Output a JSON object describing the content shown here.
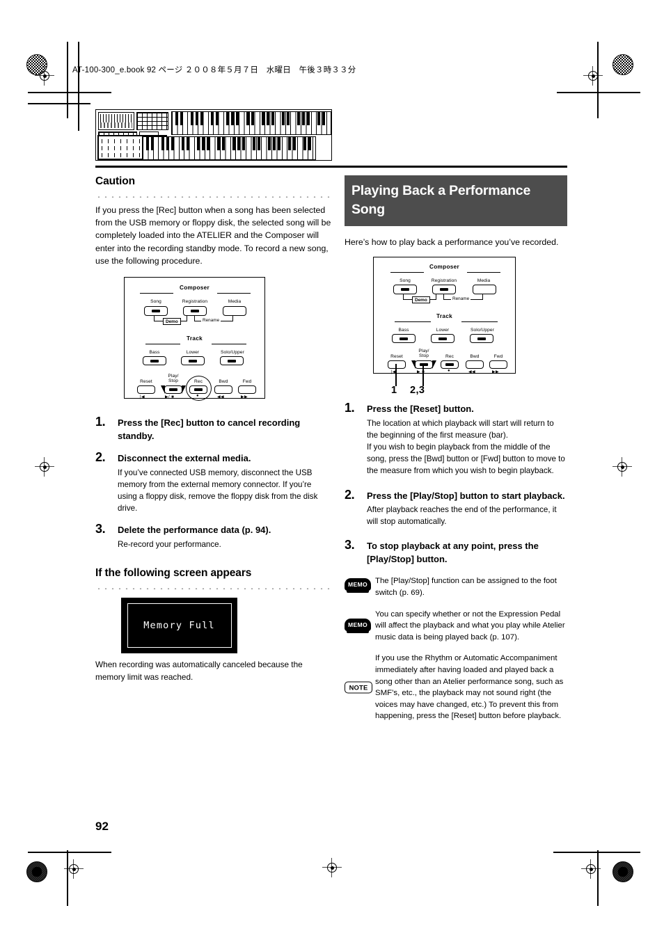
{
  "page": {
    "file_header": "AT-100-300_e.book  92 ページ  ２００８年５月７日　水曜日　午後３時３３分",
    "page_number": "92"
  },
  "left_column": {
    "caution": {
      "heading": "Caution",
      "body": "If you press the [Rec] button when a song has been selected from the USB memory or floppy disk, the selected song will be completely loaded into the ATELIER and the Composer will enter into the recording standby mode. To record a new song, use the following procedure."
    },
    "diagram": {
      "composer_label": "Composer",
      "track_label": "Track",
      "buttons": {
        "song": "Song",
        "registration": "Registration",
        "media": "Media",
        "demo": "Demo",
        "rename": "Rename",
        "bass": "Bass",
        "lower": "Lower",
        "solo_upper": "Solo/Upper",
        "reset": "Reset",
        "play_stop": "Play/\nStop",
        "play_line1": "Play/",
        "play_line2": "Stop",
        "rec": "Rec",
        "bwd": "Bwd",
        "fwd": "Fwd"
      },
      "transport_symbols": {
        "reset": "|◀",
        "play_stop": "▶/ ■",
        "rec": "●",
        "bwd": "◀◀",
        "fwd": "▶▶"
      }
    },
    "steps": [
      {
        "num": "1.",
        "lead": "Press the [Rec] button to cancel recording standby.",
        "sub": ""
      },
      {
        "num": "2.",
        "lead": "Disconnect the external media.",
        "sub": "If you’ve connected USB memory, disconnect the USB memory from the external memory connector. If you’re using a floppy disk, remove the floppy disk from the disk drive."
      },
      {
        "num": "3.",
        "lead": "Delete the performance data (p. 94).",
        "sub": "Re-record your performance."
      }
    ],
    "screen_section": {
      "heading": "If the following screen appears",
      "lcd_text": "Memory Full",
      "caption": "When recording was automatically canceled because the memory limit was reached."
    }
  },
  "right_column": {
    "banner_title": "Playing Back a Performance Song",
    "intro": "Here’s how to play back a performance you’ve recorded.",
    "diagram": {
      "composer_label": "Composer",
      "track_label": "Track",
      "buttons": {
        "song": "Song",
        "registration": "Registration",
        "media": "Media",
        "demo": "Demo",
        "rename": "Rename",
        "bass": "Bass",
        "lower": "Lower",
        "solo_upper": "Solo/Upper",
        "reset": "Reset",
        "play_line1": "Play/",
        "play_line2": "Stop",
        "rec": "Rec",
        "bwd": "Bwd",
        "fwd": "Fwd"
      },
      "transport_symbols": {
        "reset": "|◀",
        "play_stop": "▶ ■",
        "rec": "●",
        "bwd": "◀◀",
        "fwd": "▶▶"
      },
      "callouts": {
        "reset_callout": "1",
        "play_callout": "2,3"
      }
    },
    "steps": [
      {
        "num": "1.",
        "lead": "Press the [Reset] button.",
        "sub": "The location at which playback will start will return to the beginning of the first measure (bar).\nIf you wish to begin playback from the middle of the song, press the [Bwd] button or [Fwd] button to move to the measure from which you wish to begin playback."
      },
      {
        "num": "2.",
        "lead": "Press the [Play/Stop] button to start playback.",
        "sub": "After playback reaches the end of the performance, it will stop automatically."
      },
      {
        "num": "3.",
        "lead": "To stop playback at any point, press the [Play/Stop] button.",
        "sub": ""
      }
    ],
    "callouts": [
      {
        "badge": "MEMO",
        "text": "The [Play/Stop] function can be assigned to the foot switch (p. 69)."
      },
      {
        "badge": "MEMO",
        "text": "You can specify whether or not the Expression Pedal will affect the playback and what you play while Atelier music data is being played back (p. 107)."
      },
      {
        "badge": "NOTE",
        "text": "If you use the Rhythm or Automatic Accompaniment immediately after having loaded and played back a song other than an Atelier performance song, such as SMF’s, etc., the playback may not sound right (the voices may have changed, etc.) To prevent this from happening, press the [Reset] button before playback."
      }
    ]
  },
  "colors": {
    "banner_background": "#4d4d4d",
    "banner_text": "#ffffff",
    "lcd_background": "#000000",
    "lcd_text": "#ffffff",
    "rule": "#000000"
  }
}
